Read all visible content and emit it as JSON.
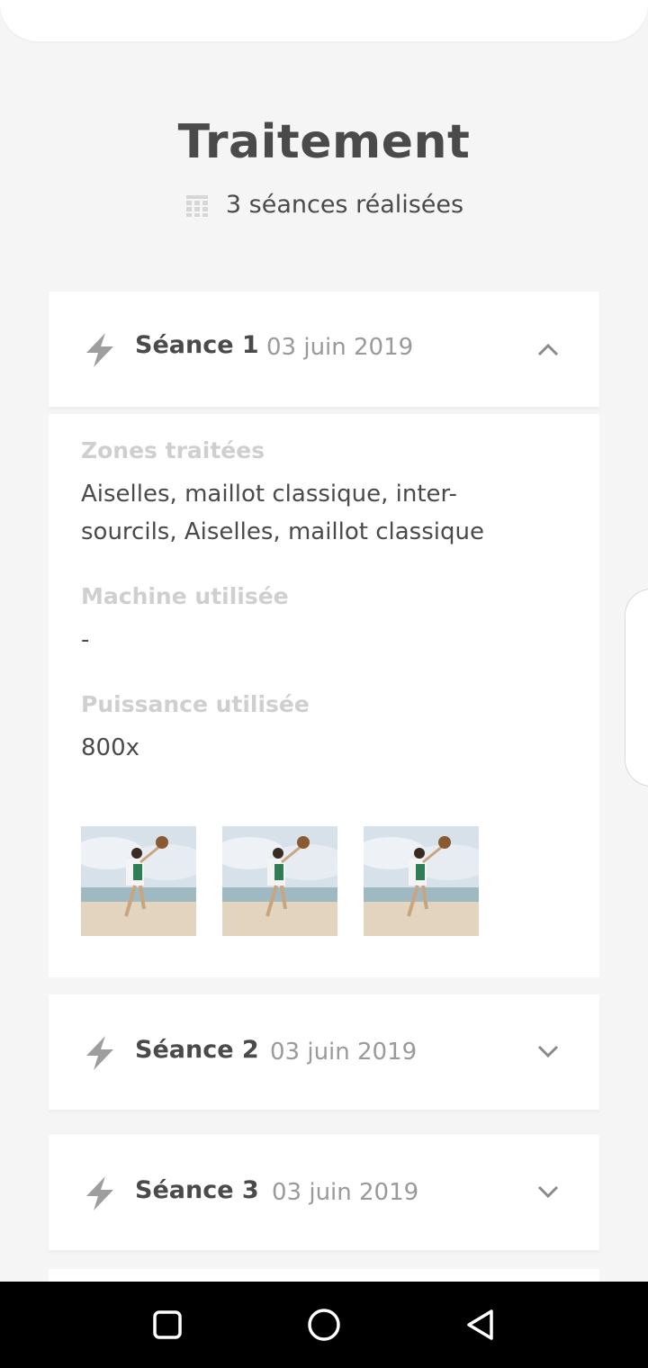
{
  "header": {
    "title": "Traitement",
    "summary": "3 séances réalisées",
    "summary_icon": "calendar-icon"
  },
  "sessions": [
    {
      "label": "Séance 1",
      "date": "03 juin 2019",
      "expanded": true,
      "chevron_icon": "chevron-up-icon",
      "details": {
        "zones_label": "Zones traitées",
        "zones_value_line1": "Aiselles, maillot classique, inter-",
        "zones_value_line2": "sourcils, Aiselles, maillot classique",
        "machine_label": "Machine utilisée",
        "machine_value": "-",
        "power_label": "Puissance utilisée",
        "power_value": "800x",
        "photos_count": 3
      }
    },
    {
      "label": "Séance 2",
      "date": "03 juin 2019",
      "expanded": false,
      "chevron_icon": "chevron-down-icon"
    },
    {
      "label": "Séance 3",
      "date": "03 juin 2019",
      "expanded": false,
      "chevron_icon": "chevron-down-icon"
    }
  ],
  "colors": {
    "background": "#f5f5f5",
    "card": "#ffffff",
    "text_dark": "#4a4a4a",
    "text_muted": "#9a9a9a",
    "label_light": "#cfcfcf",
    "icon_gray": "#9e9e9e"
  },
  "system_nav": {
    "recents_icon": "square-icon",
    "home_icon": "circle-icon",
    "back_icon": "triangle-back-icon"
  }
}
